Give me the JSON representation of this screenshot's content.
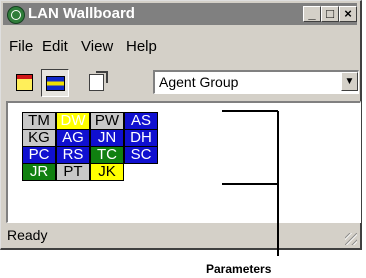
{
  "window": {
    "title": "LAN Wallboard",
    "controls": {
      "minimize": "_",
      "maximize": "□",
      "close": "×"
    }
  },
  "menu": [
    "File",
    "Edit",
    "View",
    "Help"
  ],
  "toolbar": {
    "tools": [
      {
        "icon": "calendar-icon",
        "pressed": false
      },
      {
        "icon": "bars-view-icon",
        "pressed": true
      },
      {
        "icon": "properties-icon",
        "pressed": false
      }
    ],
    "combo_value": "Agent Group",
    "combo_arrow": "▼"
  },
  "agents": [
    [
      {
        "code": "TM",
        "fill": "#c8c8c8",
        "text": "#000000"
      },
      {
        "code": "DW",
        "fill": "#ffff00",
        "text": "#ffffff"
      },
      {
        "code": "PW",
        "fill": "#c8c8c8",
        "text": "#000000"
      },
      {
        "code": "AS",
        "fill": "#1010d0",
        "text": "#ffffff"
      }
    ],
    [
      {
        "code": "KG",
        "fill": "#c8c8c8",
        "text": "#000000"
      },
      {
        "code": "AG",
        "fill": "#1010d0",
        "text": "#ffffff"
      },
      {
        "code": "JN",
        "fill": "#1010d0",
        "text": "#ffffff"
      },
      {
        "code": "DH",
        "fill": "#1010d0",
        "text": "#ffffff"
      }
    ],
    [
      {
        "code": "PC",
        "fill": "#1010d0",
        "text": "#ffffff"
      },
      {
        "code": "RS",
        "fill": "#1010d0",
        "text": "#ffffff"
      },
      {
        "code": "TC",
        "fill": "#108010",
        "text": "#ffffff"
      },
      {
        "code": "SC",
        "fill": "#1010d0",
        "text": "#ffffff"
      }
    ],
    [
      {
        "code": "JR",
        "fill": "#108010",
        "text": "#ffffff"
      },
      {
        "code": "PT",
        "fill": "#c8c8c8",
        "text": "#000000"
      },
      {
        "code": "JK",
        "fill": "#ffff00",
        "text": "#000000"
      }
    ]
  ],
  "status": "Ready",
  "callout": {
    "label": "Parameters"
  }
}
